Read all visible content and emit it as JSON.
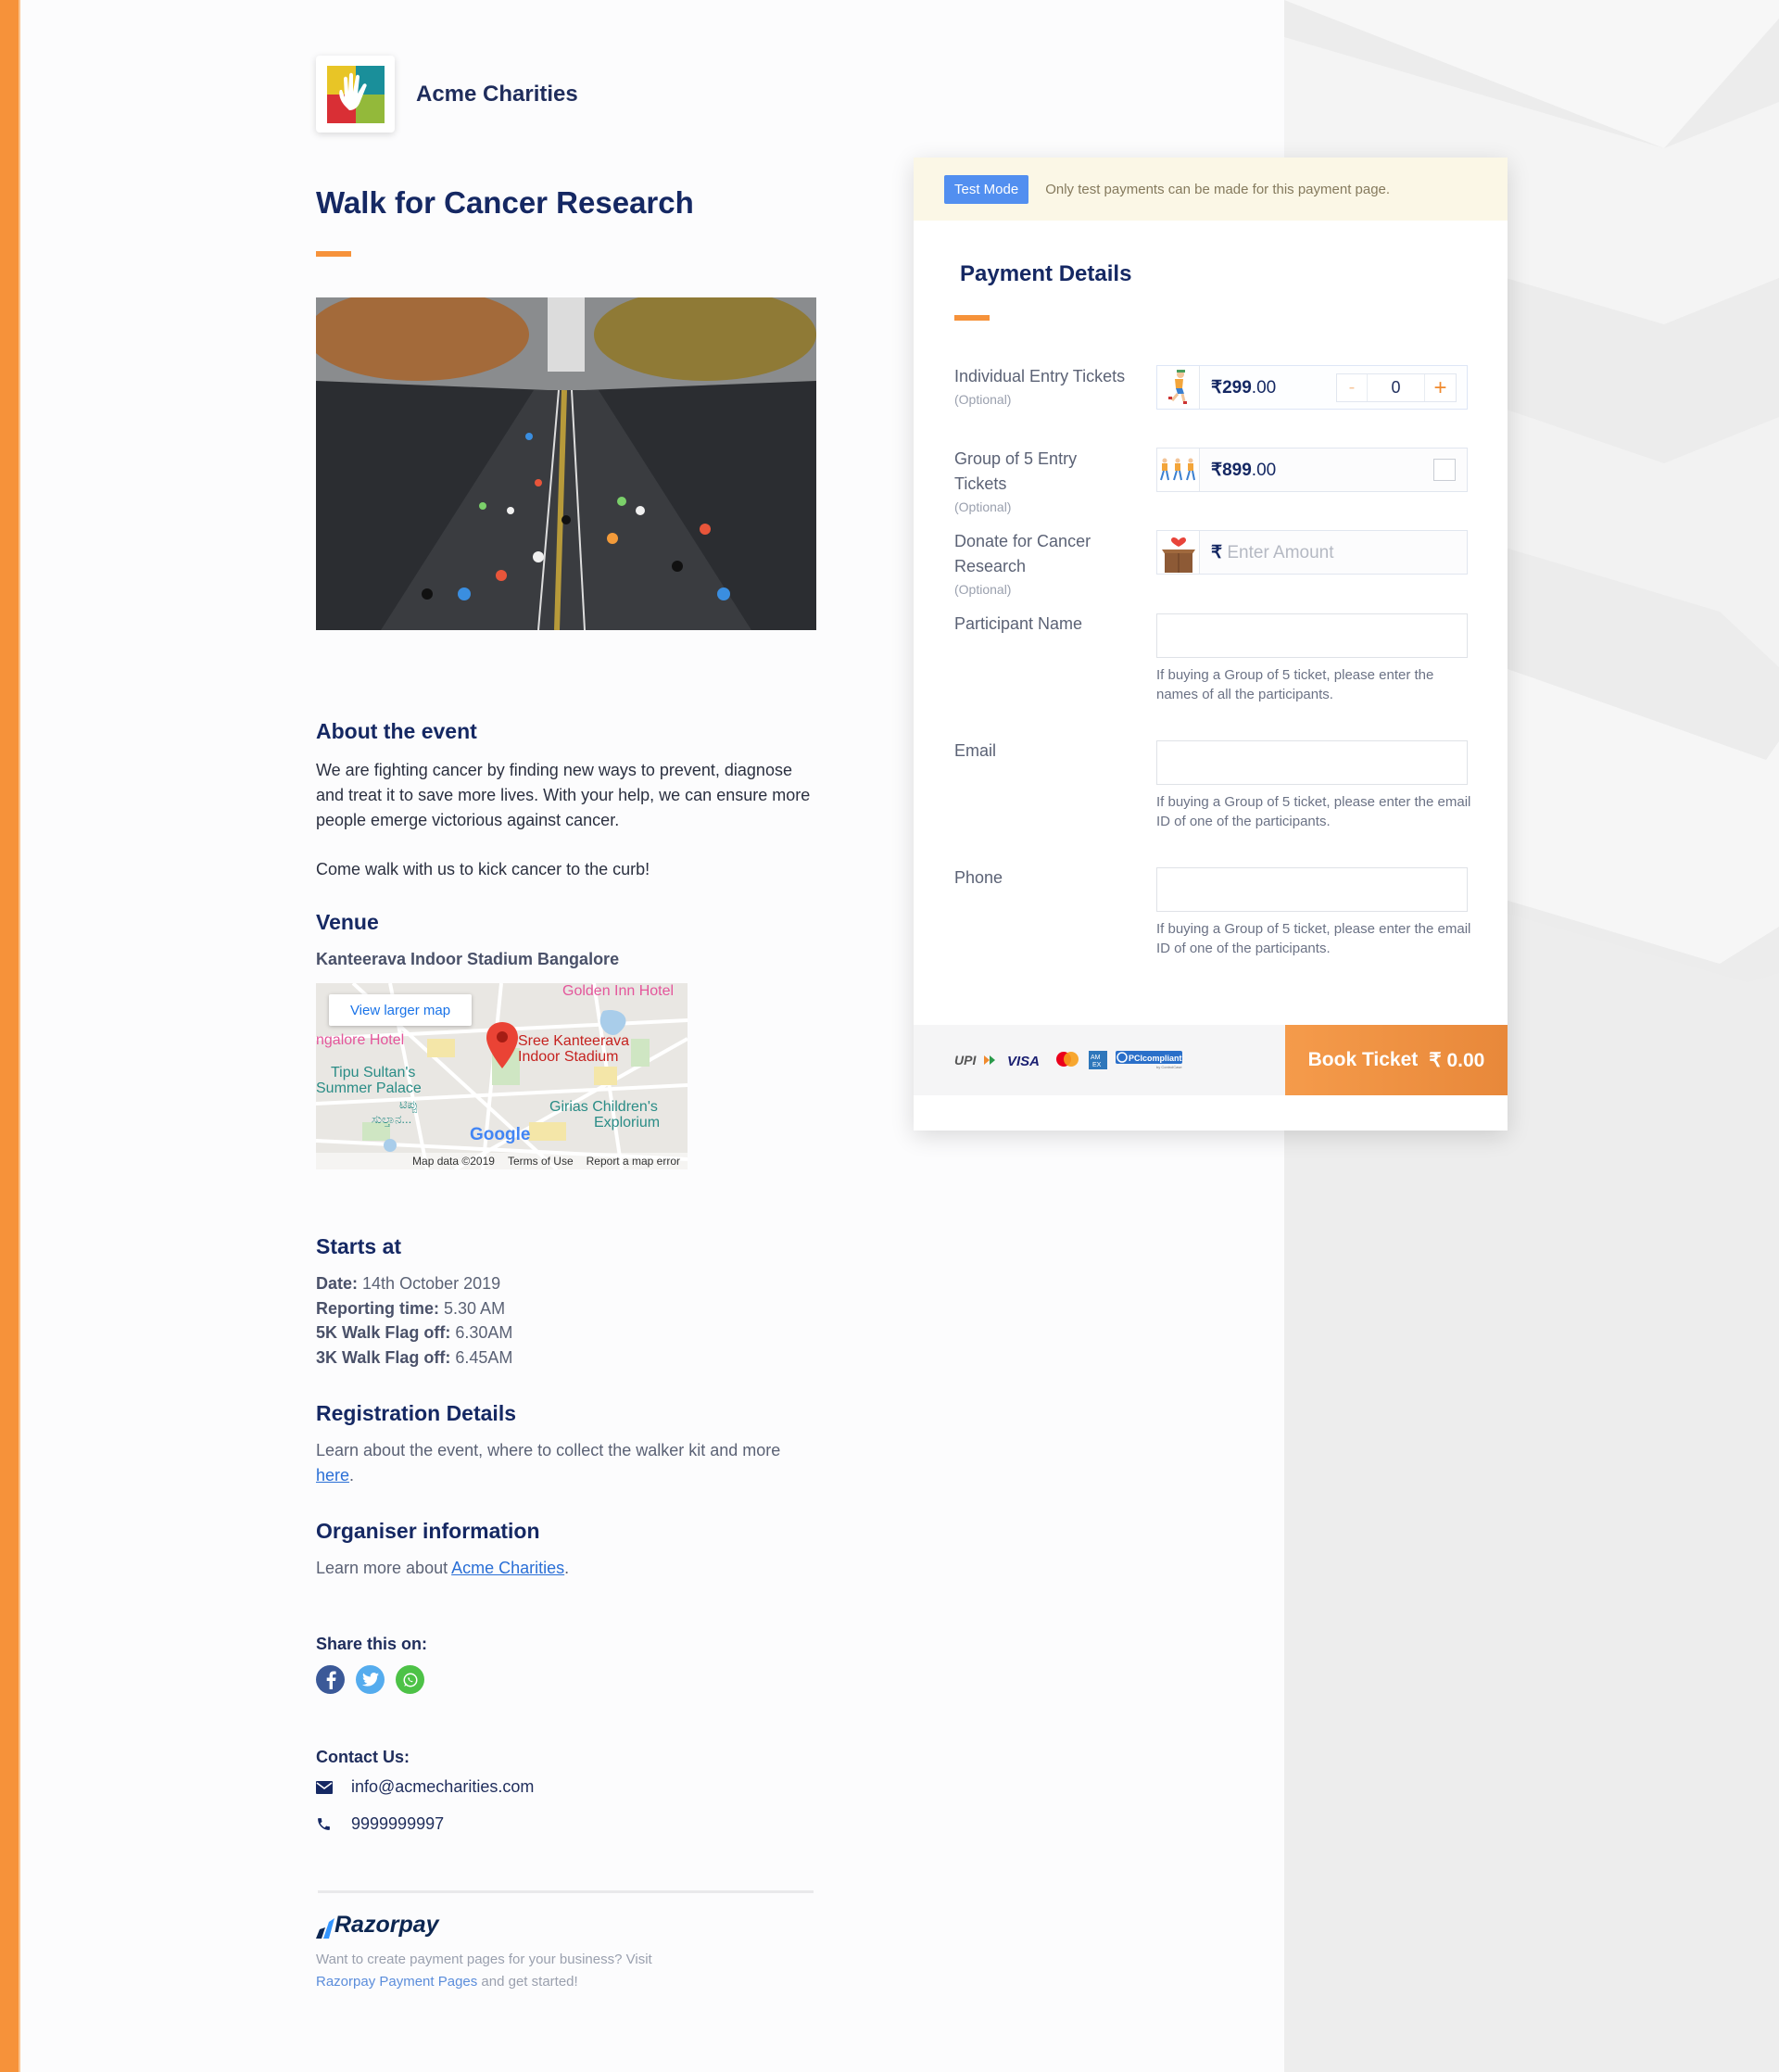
{
  "brand": {
    "name": "Acme Charities",
    "logo_icon": "hand-logo-icon"
  },
  "page": {
    "title": "Walk for Cancer Research",
    "hero_image": "marathon-runners-photo"
  },
  "about": {
    "heading": "About the event",
    "paragraph1": "We are fighting cancer by finding new ways to prevent, diagnose and treat it to save more lives. With your help, we can ensure more people emerge victorious against cancer.",
    "paragraph2": "Come walk with us to kick cancer to the curb!"
  },
  "venue": {
    "heading": "Venue",
    "name": "Kanteerava Indoor Stadium Bangalore",
    "map": {
      "view_larger": "View larger map",
      "pin_label_line1": "Sree Kanteerava",
      "pin_label_line2": "Indoor Stadium",
      "places": [
        "Golden Inn Hotel",
        "ngalore Hotel",
        "Tipu Sultan's",
        "Summer Palace",
        "ಟಿಪ್ಪು",
        "ಸುಲ್ತಾನ...",
        "Girias Children's",
        "Explorium"
      ],
      "google": "Google",
      "footer": [
        "Map data ©2019",
        "Terms of Use",
        "Report a map error"
      ]
    }
  },
  "starts": {
    "heading": "Starts at",
    "rows": [
      {
        "label": "Date:",
        "value": "14th October 2019"
      },
      {
        "label": "Reporting time:",
        "value": "5.30 AM"
      },
      {
        "label": "5K Walk Flag off:",
        "value": "6.30AM"
      },
      {
        "label": "3K Walk Flag off:",
        "value": "6.45AM"
      }
    ]
  },
  "registration": {
    "heading": "Registration Details",
    "text_before": "Learn about the event, where to collect the walker kit and more ",
    "link": "here",
    "text_after": "."
  },
  "organiser": {
    "heading": "Organiser information",
    "text_before": "Learn more about ",
    "link": "Acme Charities",
    "text_after": "."
  },
  "share": {
    "heading": "Share this on:",
    "networks": [
      "facebook",
      "twitter",
      "whatsapp"
    ]
  },
  "contact": {
    "heading": "Contact Us:",
    "email": "info@acmecharities.com",
    "phone": "9999999997"
  },
  "footer": {
    "brand": "Razorpay",
    "text_before": "Want to create payment pages for your business? Visit ",
    "link": "Razorpay Payment Pages",
    "text_after": " and get started!"
  },
  "payment": {
    "test_badge": "Test Mode",
    "test_message": "Only test payments can be made for this payment page.",
    "title": "Payment Details",
    "currency_symbol": "₹",
    "items": [
      {
        "label": "Individual Entry Tickets",
        "optional": "(Optional)",
        "amount_main": "299",
        "amount_decimal": ".00",
        "quantity": "0",
        "minus": "-",
        "plus": "+"
      },
      {
        "label": "Group of 5 Entry Tickets",
        "optional": "(Optional)",
        "amount_main": "899",
        "amount_decimal": ".00",
        "checked": false
      },
      {
        "label": "Donate for Cancer Research",
        "optional": "(Optional)",
        "placeholder": "Enter Amount"
      }
    ],
    "fields": [
      {
        "label": "Participant Name",
        "value": "",
        "hint": "If buying a Group of 5 ticket, please enter the names of all the participants."
      },
      {
        "label": "Email",
        "value": "",
        "hint": "If buying a Group of 5 ticket, please enter the email ID of one of the participants."
      },
      {
        "label": "Phone",
        "value": "",
        "hint": "If buying a Group of 5 ticket, please enter the email ID of one of the participants."
      }
    ],
    "payment_methods": [
      "UPI",
      "VISA",
      "mastercard",
      "AMEX",
      "PCI compliant"
    ],
    "book_button": {
      "label": "Book Ticket",
      "amount": "₹ 0.00"
    }
  },
  "colors": {
    "accent": "#f6923a",
    "navy": "#152863",
    "test_badge": "#528ff0",
    "link": "#2a6fd6"
  }
}
